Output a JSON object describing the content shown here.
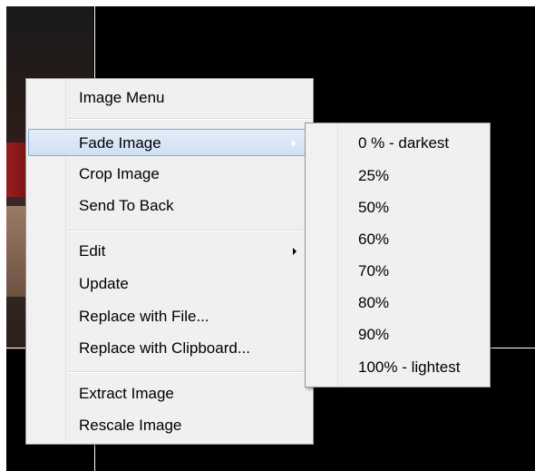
{
  "context_menu": {
    "items": [
      {
        "label": "Image Menu"
      },
      {
        "label": "Fade Image",
        "has_submenu": true,
        "highlighted": true
      },
      {
        "label": "Crop Image"
      },
      {
        "label": "Send To Back"
      },
      {
        "label": "Edit",
        "has_submenu": true
      },
      {
        "label": "Update"
      },
      {
        "label": "Replace with File..."
      },
      {
        "label": "Replace with Clipboard..."
      },
      {
        "label": "Extract Image"
      },
      {
        "label": "Rescale Image"
      }
    ]
  },
  "fade_submenu": {
    "items": [
      {
        "label": "0 % - darkest"
      },
      {
        "label": "25%"
      },
      {
        "label": "50%"
      },
      {
        "label": "60%"
      },
      {
        "label": "70%"
      },
      {
        "label": "80%"
      },
      {
        "label": "90%"
      },
      {
        "label": "100% - lightest"
      }
    ]
  },
  "colors": {
    "highlight_border": "#82a9dc",
    "highlight_fill": "#cfe0f3",
    "menu_background": "#f0f0f0"
  },
  "icons": {
    "submenu_arrow": "chevron-right-icon"
  }
}
